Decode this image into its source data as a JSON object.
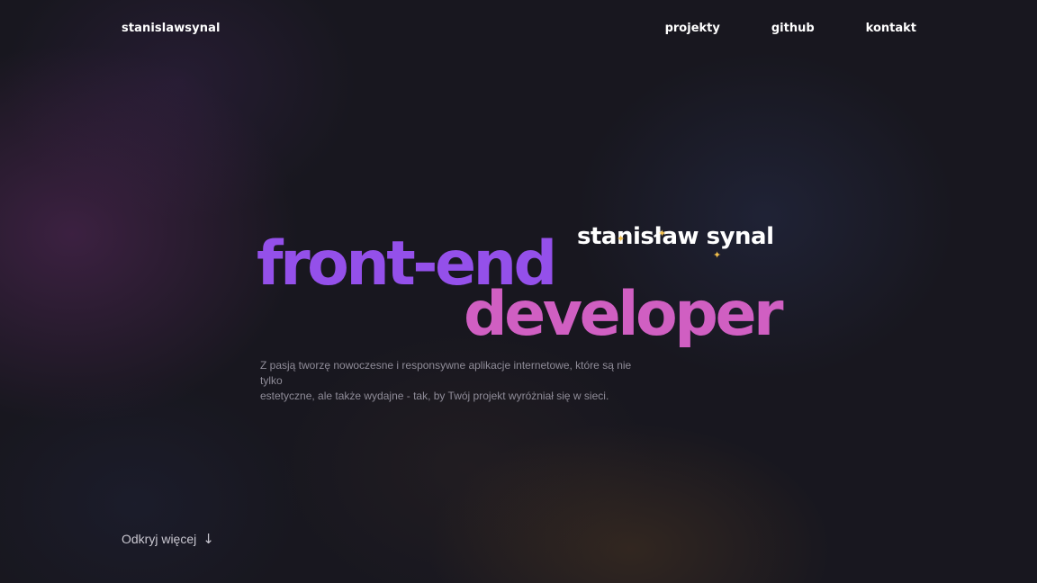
{
  "nav": {
    "logo": "stanislawsynal",
    "links": [
      "projekty",
      "github",
      "kontakt"
    ]
  },
  "hero": {
    "name_tag": "stanisław synal",
    "headline_line1": "front-end",
    "headline_line2": "developer",
    "description_line1": "Z pasją tworzę nowoczesne i responsywne aplikacje internetowe, które są nie tylko",
    "description_line2": "estetyczne, ale także wydajne - tak, by Twój projekt wyróżniał się w sieci."
  },
  "cta": {
    "label": "Odkryj więcej",
    "icon": "arrow-down-icon"
  },
  "colors": {
    "background": "#18171f",
    "headline_start": "#8d4cec",
    "headline_end": "#e266b4",
    "sparkle": "#f0bd4a"
  }
}
